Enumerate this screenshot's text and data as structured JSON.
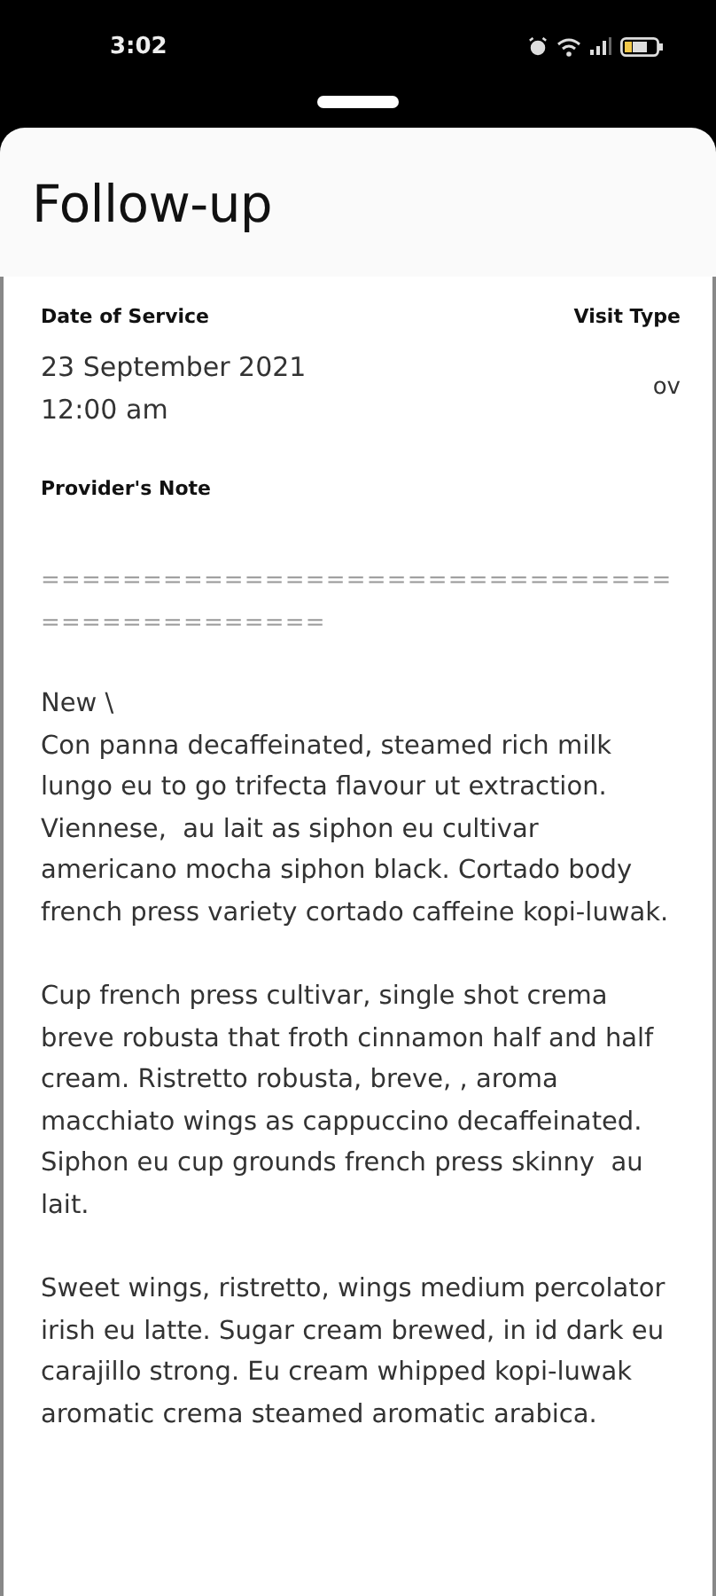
{
  "status_bar": {
    "time": "3:02"
  },
  "title": "Follow-up",
  "visit": {
    "date_label": "Date of Service",
    "date": "23 September 2021",
    "time": "12:00 am",
    "type_label": "Visit Type",
    "type": "ov"
  },
  "note": {
    "label": "Provider's Note",
    "paragraphs": [
      {
        "kind": "rule",
        "text": "============================================="
      },
      {
        "kind": "text",
        "text": "New \\\nCon panna decaffeinated, steamed rich milk lungo eu to go trifecta flavour ut extraction. Viennese,  au lait as siphon eu cultivar americano mocha siphon black. Cortado body french press variety cortado caffeine kopi-luwak."
      },
      {
        "kind": "text",
        "text": "Cup french press cultivar, single shot crema breve robusta that froth cinnamon half and half cream. Ristretto robusta, breve, , aroma macchiato wings as cappuccino decaffeinated. Siphon eu cup grounds french press skinny  au lait."
      },
      {
        "kind": "text",
        "text": "Sweet wings, ristretto, wings medium percolator irish eu latte. Sugar cream brewed, in id dark eu carajillo strong. Eu cream whipped kopi-luwak aromatic crema steamed aromatic arabica."
      }
    ]
  }
}
